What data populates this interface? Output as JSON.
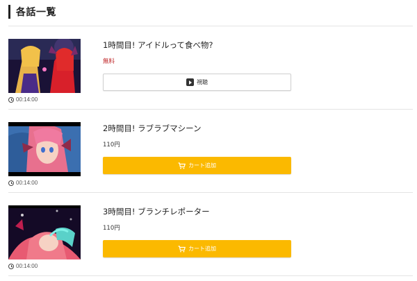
{
  "section": {
    "title": "各話一覧"
  },
  "episodes": [
    {
      "title": "1時間目! アイドルって食べ物?",
      "price": "無料",
      "free": true,
      "duration": "00:14:00",
      "button_label": "視聴",
      "button_type": "watch",
      "button_icon": "play-icon"
    },
    {
      "title": "2時間目! ラブラブマシーン",
      "price": "110円",
      "free": false,
      "duration": "00:14:00",
      "button_label": "カート追加",
      "button_type": "cart",
      "button_icon": "cart-icon"
    },
    {
      "title": "3時間目! ブランチレポーター",
      "price": "110円",
      "free": false,
      "duration": "00:14:00",
      "button_label": "カート追加",
      "button_type": "cart",
      "button_icon": "cart-icon"
    }
  ],
  "colors": {
    "cart_button": "#fbb900",
    "free_price": "#c0292b"
  }
}
